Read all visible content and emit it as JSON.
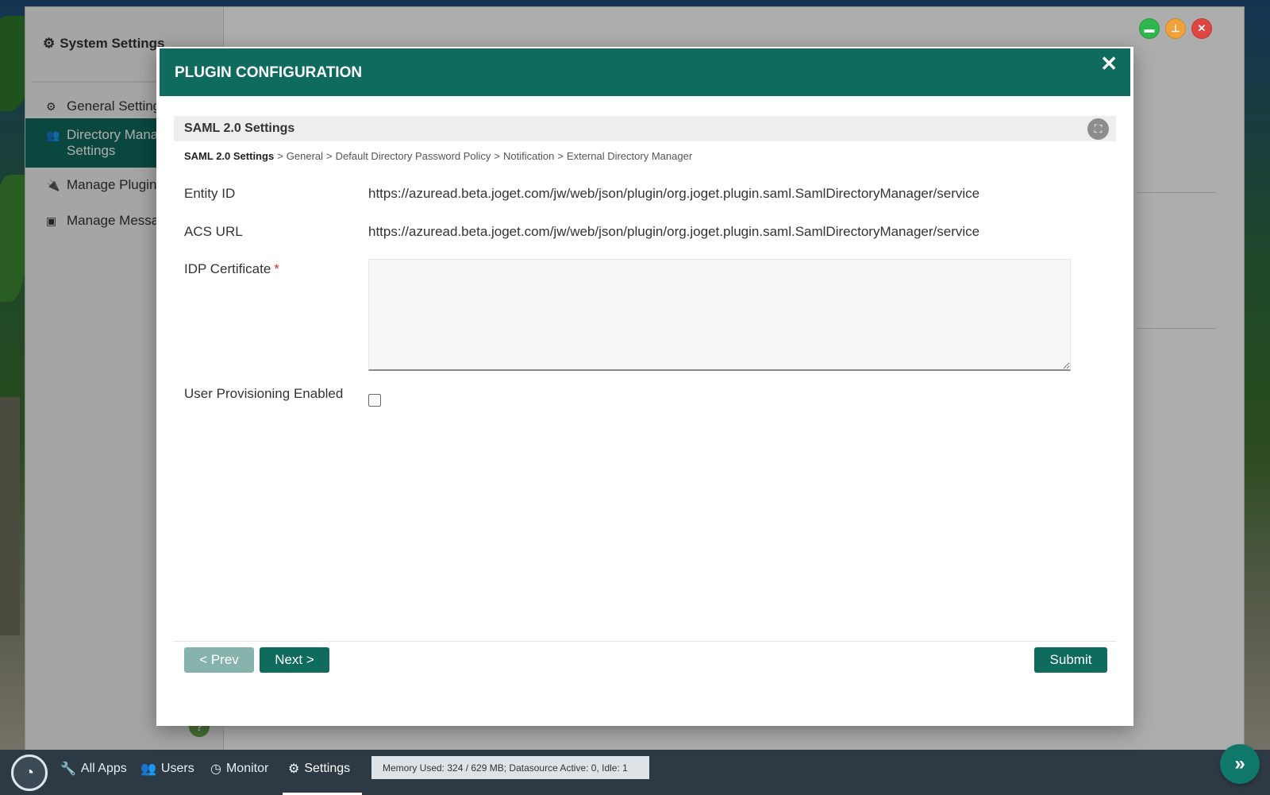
{
  "window": {
    "sidebar_title": "System Settings",
    "sidebar_items": [
      {
        "label": "General Settings",
        "icon": "gear-icon"
      },
      {
        "label": "Directory Manager Settings",
        "icon": "users-icon",
        "active": true
      },
      {
        "label": "Manage Plugins",
        "icon": "plug-icon"
      },
      {
        "label": "Manage Messages",
        "icon": "message-icon"
      }
    ],
    "help": "?"
  },
  "modal": {
    "title": "PLUGIN CONFIGURATION",
    "close": "✕",
    "section_title": "SAML 2.0 Settings",
    "breadcrumb": [
      {
        "label": "SAML 2.0 Settings",
        "current": true
      },
      {
        "label": "General"
      },
      {
        "label": "Default Directory Password Policy"
      },
      {
        "label": "Notification"
      },
      {
        "label": "External Directory Manager"
      }
    ],
    "breadcrumb_sep": ">",
    "fields": {
      "entity_id_label": "Entity ID",
      "entity_id_value": "https://azuread.beta.joget.com/jw/web/json/plugin/org.joget.plugin.saml.SamlDirectoryManager/service",
      "acs_url_label": "ACS URL",
      "acs_url_value": "https://azuread.beta.joget.com/jw/web/json/plugin/org.joget.plugin.saml.SamlDirectoryManager/service",
      "idp_cert_label": "IDP Certificate",
      "idp_cert_required": "*",
      "idp_cert_value": "",
      "user_prov_label": "User Provisioning Enabled",
      "user_prov_checked": false
    },
    "buttons": {
      "prev": "< Prev",
      "next": "Next >",
      "submit": "Submit"
    }
  },
  "taskbar": {
    "items": [
      {
        "label": "All Apps",
        "icon": "wrench-icon"
      },
      {
        "label": "Users",
        "icon": "users-icon"
      },
      {
        "label": "Monitor",
        "icon": "dashboard-icon"
      },
      {
        "label": "Settings",
        "icon": "gears-icon",
        "active": true
      }
    ],
    "memory": "Memory Used: 324 / 629 MB; Datasource Active: 0, Idle: 1",
    "fab": "»"
  },
  "colors": {
    "primary": "#0f6b5e",
    "prev_disabled": "#86b3ab",
    "required": "#d9262b",
    "taskbar": "#2d3a44"
  }
}
